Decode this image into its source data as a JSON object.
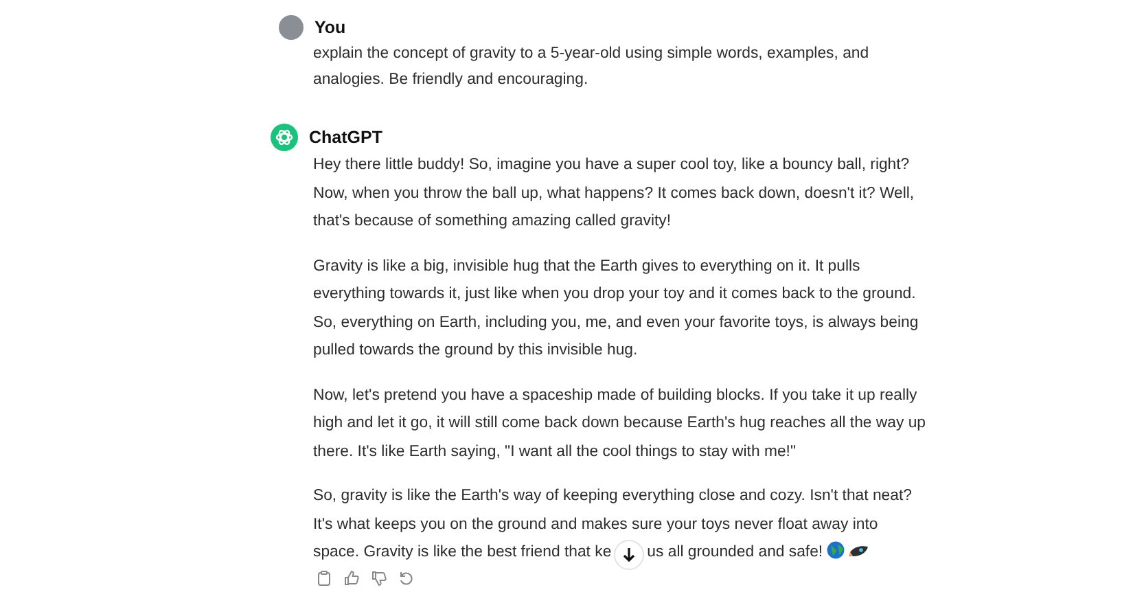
{
  "messages": [
    {
      "kind": "user",
      "author": "You",
      "paragraphs": [
        "explain the concept of gravity to a 5-year-old using simple words, examples, and analogies. Be friendly and encouraging."
      ]
    },
    {
      "kind": "assistant",
      "author": "ChatGPT",
      "paragraphs": [
        "Hey there little buddy! So, imagine you have a super cool toy, like a bouncy ball, right? Now, when you throw the ball up, what happens? It comes back down, doesn't it? Well, that's because of something amazing called gravity!",
        "Gravity is like a big, invisible hug that the Earth gives to everything on it. It pulls everything towards it, just like when you drop your toy and it comes back to the ground. So, everything on Earth, including you, me, and even your favorite toys, is always being pulled towards the ground by this invisible hug.",
        "Now, let's pretend you have a spaceship made of building blocks. If you take it up really high and let it go, it will still come back down because Earth's hug reaches all the way up there. It's like Earth saying, \"I want all the cool things to stay with me!\""
      ],
      "last_paragraph": {
        "text": "So, gravity is like the Earth's way of keeping everything close and cozy. Isn't that neat? It's what keeps you on the ground and makes sure your toys never float away into",
        "before": "space. Gravity is like the best friend that ke",
        "after": "us all grounded and safe!"
      }
    }
  ]
}
